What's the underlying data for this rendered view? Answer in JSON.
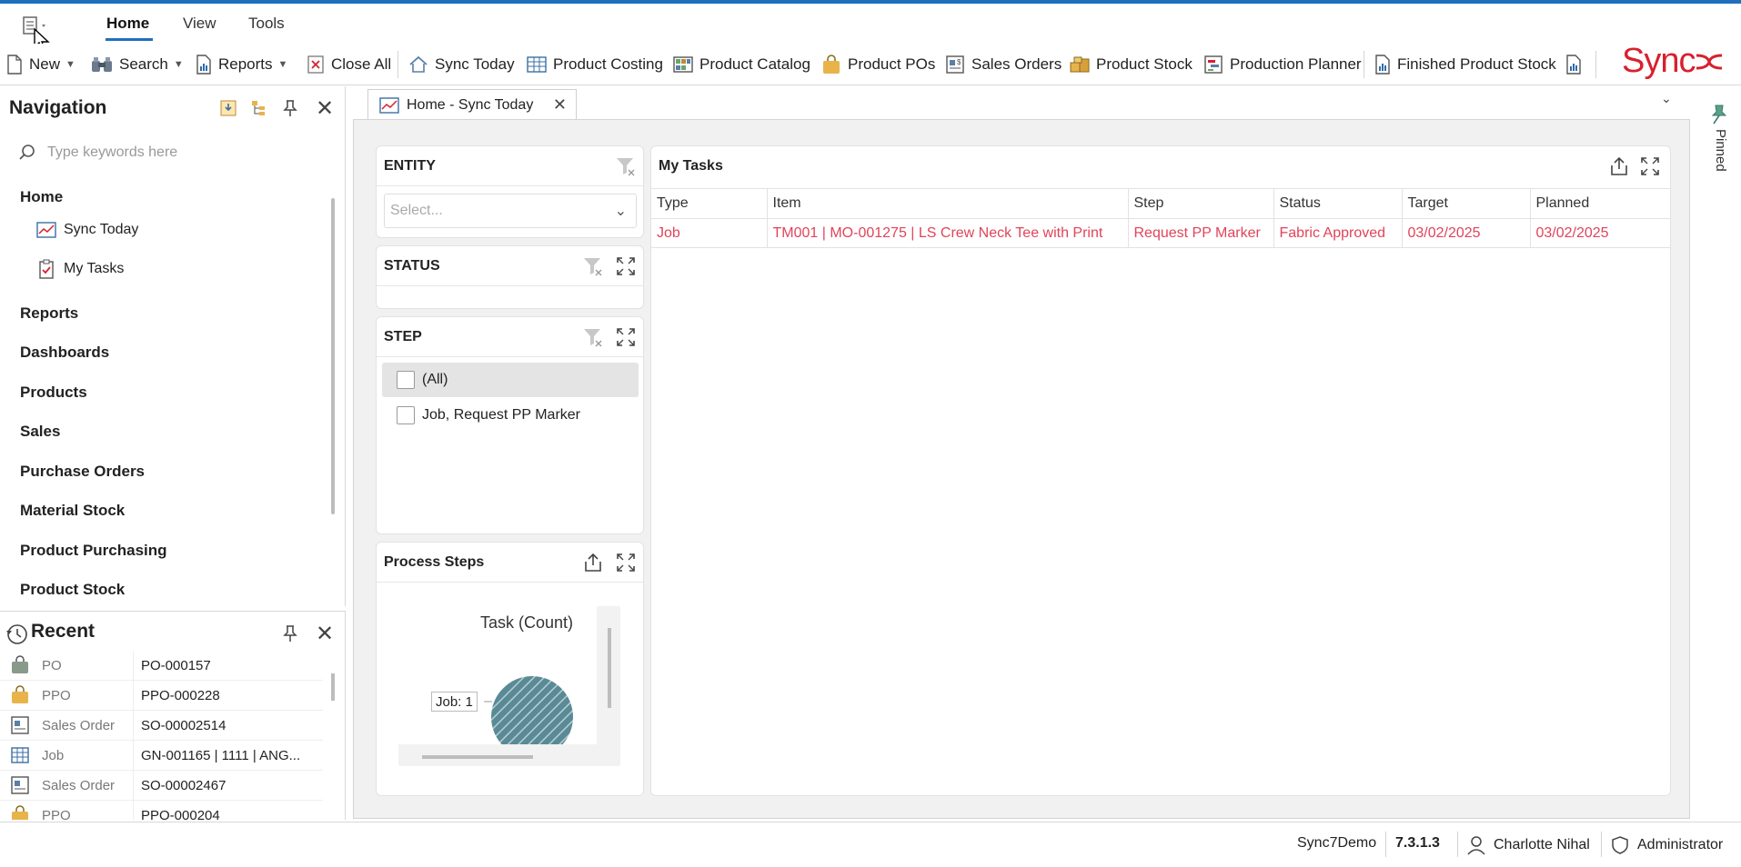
{
  "menubar": {
    "tabs": [
      {
        "label": "Home",
        "active": true
      },
      {
        "label": "View",
        "active": false
      },
      {
        "label": "Tools",
        "active": false
      }
    ]
  },
  "toolbar": {
    "new": "New",
    "search": "Search",
    "reports": "Reports",
    "close_all": "Close All",
    "sync_today": "Sync Today",
    "product_costing": "Product Costing",
    "product_catalog": "Product Catalog",
    "product_pos": "Product POs",
    "sales_orders": "Sales Orders",
    "product_stock": "Product Stock",
    "production_planner": "Production Planner",
    "finished_product_stock": "Finished Product Stock"
  },
  "logo": {
    "text": "Sync",
    "color": "#d8202e"
  },
  "navigation": {
    "title": "Navigation",
    "search_placeholder": "Type keywords here",
    "groups": {
      "home": "Home",
      "reports": "Reports",
      "dashboards": "Dashboards",
      "products": "Products",
      "sales": "Sales",
      "purchase_orders": "Purchase Orders",
      "material_stock": "Material Stock",
      "product_purchasing": "Product Purchasing",
      "product_stock": "Product Stock"
    },
    "home_items": [
      {
        "label": "Sync Today",
        "icon": "chart-icon"
      },
      {
        "label": "My Tasks",
        "icon": "clipboard-check-icon"
      }
    ]
  },
  "recent": {
    "title": "Recent",
    "items": [
      {
        "type": "PO",
        "value": "PO-000157",
        "icon": "bag-icon"
      },
      {
        "type": "PPO",
        "value": "PPO-000228",
        "icon": "bag-icon"
      },
      {
        "type": "Sales Order",
        "value": "SO-00002514",
        "icon": "sales-order-icon"
      },
      {
        "type": "Job",
        "value": "GN-001165 | 1111 | ANG...",
        "icon": "grid-icon"
      },
      {
        "type": "Sales Order",
        "value": "SO-00002467",
        "icon": "sales-order-icon"
      },
      {
        "type": "PPO",
        "value": "PPO-000204",
        "icon": "bag-icon"
      }
    ]
  },
  "document_tab": {
    "label": "Home - Sync Today"
  },
  "filters": {
    "entity": {
      "title": "ENTITY",
      "placeholder": "Select..."
    },
    "status": {
      "title": "STATUS"
    },
    "step": {
      "title": "STEP",
      "options": [
        {
          "label": "(All)",
          "checked": false
        },
        {
          "label": "Job, Request PP Marker",
          "checked": false
        }
      ]
    }
  },
  "process_steps": {
    "title": "Process Steps",
    "chart_title": "Task (Count)"
  },
  "chart_data": {
    "type": "pie",
    "title": "Task (Count)",
    "categories": [
      "Job"
    ],
    "values": [
      1
    ],
    "data_labels": [
      "Job: 1"
    ],
    "colors": [
      "#5a8a95"
    ]
  },
  "my_tasks": {
    "title": "My Tasks",
    "columns": [
      "Type",
      "Item",
      "Step",
      "Status",
      "Target",
      "Planned"
    ],
    "rows": [
      {
        "type": "Job",
        "item": "TM001 | MO-001275 | LS Crew Neck Tee with Print",
        "step": "Request PP Marker",
        "status": "Fabric Approved",
        "target": "03/02/2025",
        "planned": "03/02/2025"
      }
    ],
    "row_color": "#e0445a"
  },
  "pinned": {
    "label": "Pinned"
  },
  "statusbar": {
    "database": "Sync7Demo",
    "version": "7.3.1.3",
    "user": "Charlotte Nihal",
    "role": "Administrator"
  }
}
